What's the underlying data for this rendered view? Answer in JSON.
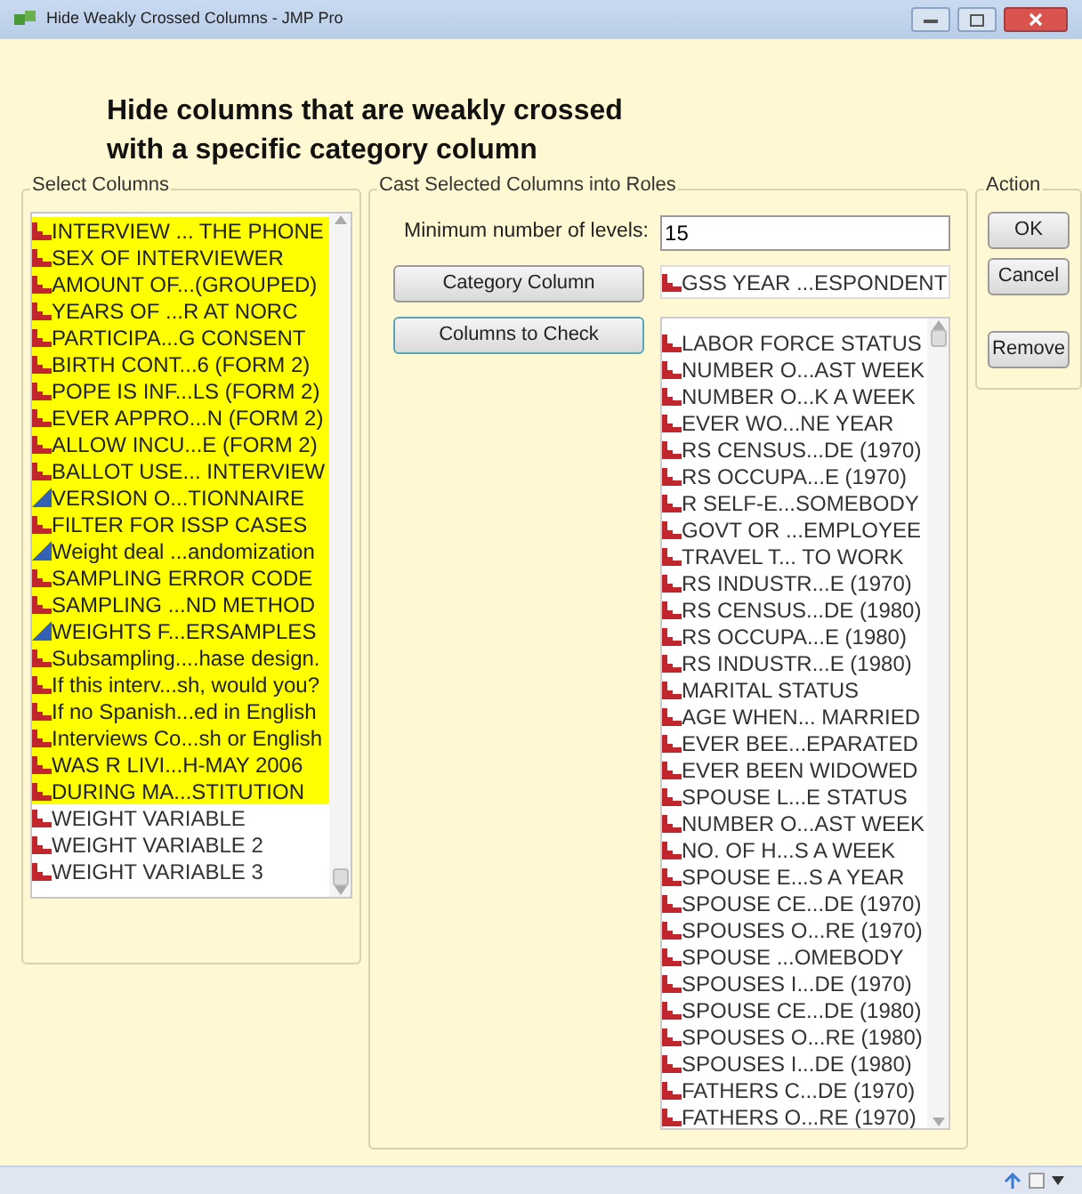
{
  "window": {
    "title": "Hide Weakly Crossed Columns - JMP Pro"
  },
  "heading": [
    "Hide columns that are weakly crossed",
    "with a specific category column"
  ],
  "select_columns": {
    "title": "Select Columns",
    "items": [
      {
        "label": "INTERVIEW ... THE PHONE",
        "kind": "nominal",
        "selected": true
      },
      {
        "label": "SEX OF INTERVIEWER",
        "kind": "nominal",
        "selected": true
      },
      {
        "label": "AMOUNT OF...(GROUPED)",
        "kind": "nominal",
        "selected": true
      },
      {
        "label": "YEARS OF ...R AT NORC",
        "kind": "nominal",
        "selected": true
      },
      {
        "label": "PARTICIPA...G CONSENT",
        "kind": "nominal",
        "selected": true
      },
      {
        "label": "BIRTH CONT...6 (FORM 2)",
        "kind": "nominal",
        "selected": true
      },
      {
        "label": "POPE IS INF...LS (FORM 2)",
        "kind": "nominal",
        "selected": true
      },
      {
        "label": "EVER APPRO...N (FORM 2)",
        "kind": "nominal",
        "selected": true
      },
      {
        "label": "ALLOW INCU...E (FORM 2)",
        "kind": "nominal",
        "selected": true
      },
      {
        "label": "BALLOT USE... INTERVIEW",
        "kind": "nominal",
        "selected": true
      },
      {
        "label": "VERSION O...TIONNAIRE",
        "kind": "continuous",
        "selected": true
      },
      {
        "label": "FILTER FOR ISSP CASES",
        "kind": "nominal",
        "selected": true
      },
      {
        "label": "Weight deal ...andomization",
        "kind": "continuous",
        "selected": true
      },
      {
        "label": "SAMPLING ERROR CODE",
        "kind": "nominal",
        "selected": true
      },
      {
        "label": "SAMPLING ...ND METHOD",
        "kind": "nominal",
        "selected": true
      },
      {
        "label": "WEIGHTS F...ERSAMPLES",
        "kind": "continuous",
        "selected": true
      },
      {
        "label": "Subsampling....hase design.",
        "kind": "nominal",
        "selected": true
      },
      {
        "label": "If this interv...sh, would you?",
        "kind": "nominal",
        "selected": true
      },
      {
        "label": "If no Spanish...ed in English",
        "kind": "nominal",
        "selected": true
      },
      {
        "label": "Interviews Co...sh or English",
        "kind": "nominal",
        "selected": true
      },
      {
        "label": "WAS R LIVI...H-MAY 2006",
        "kind": "nominal",
        "selected": true
      },
      {
        "label": "DURING MA...STITUTION",
        "kind": "nominal",
        "selected": true
      },
      {
        "label": "WEIGHT VARIABLE",
        "kind": "nominal",
        "selected": false
      },
      {
        "label": "WEIGHT VARIABLE 2",
        "kind": "nominal",
        "selected": false
      },
      {
        "label": "WEIGHT VARIABLE 3",
        "kind": "nominal",
        "selected": false
      }
    ]
  },
  "cast_roles": {
    "title": "Cast Selected Columns into Roles",
    "minimum_levels": {
      "label": "Minimum number of levels:",
      "value": "15"
    },
    "category_column": {
      "button": "Category Column",
      "items": [
        {
          "label": "GSS YEAR ...ESPONDENT",
          "kind": "nominal"
        }
      ]
    },
    "columns_to_check": {
      "button": "Columns to Check",
      "items": [
        {
          "label": "LABOR FORCE STATUS",
          "kind": "nominal"
        },
        {
          "label": "NUMBER O...AST WEEK",
          "kind": "nominal"
        },
        {
          "label": "NUMBER O...K A WEEK",
          "kind": "nominal"
        },
        {
          "label": "EVER WO...NE YEAR",
          "kind": "nominal"
        },
        {
          "label": "RS CENSUS...DE (1970)",
          "kind": "nominal"
        },
        {
          "label": "RS OCCUPA...E  (1970)",
          "kind": "nominal"
        },
        {
          "label": "R SELF-E...SOMEBODY",
          "kind": "nominal"
        },
        {
          "label": "GOVT OR ...EMPLOYEE",
          "kind": "nominal"
        },
        {
          "label": "TRAVEL T... TO WORK",
          "kind": "nominal"
        },
        {
          "label": "RS INDUSTR...E  (1970)",
          "kind": "nominal"
        },
        {
          "label": "RS CENSUS...DE (1980)",
          "kind": "nominal"
        },
        {
          "label": "RS OCCUPA...E  (1980)",
          "kind": "nominal"
        },
        {
          "label": "RS INDUSTR...E  (1980)",
          "kind": "nominal"
        },
        {
          "label": "MARITAL STATUS",
          "kind": "nominal"
        },
        {
          "label": "AGE WHEN... MARRIED",
          "kind": "nominal"
        },
        {
          "label": "EVER BEE...EPARATED",
          "kind": "nominal"
        },
        {
          "label": "EVER BEEN WIDOWED",
          "kind": "nominal"
        },
        {
          "label": "SPOUSE L...E STATUS",
          "kind": "nominal"
        },
        {
          "label": "NUMBER O...AST WEEK",
          "kind": "nominal"
        },
        {
          "label": "NO. OF H...S A WEEK",
          "kind": "nominal"
        },
        {
          "label": "SPOUSE E...S A YEAR",
          "kind": "nominal"
        },
        {
          "label": "SPOUSE CE...DE (1970)",
          "kind": "nominal"
        },
        {
          "label": "SPOUSES O...RE (1970)",
          "kind": "nominal"
        },
        {
          "label": "SPOUSE ...OMEBODY",
          "kind": "nominal"
        },
        {
          "label": "SPOUSES I...DE (1970)",
          "kind": "nominal"
        },
        {
          "label": "SPOUSE CE...DE (1980)",
          "kind": "nominal"
        },
        {
          "label": "SPOUSES O...RE (1980)",
          "kind": "nominal"
        },
        {
          "label": "SPOUSES I...DE (1980)",
          "kind": "nominal"
        },
        {
          "label": "FATHERS C...DE (1970)",
          "kind": "nominal"
        },
        {
          "label": "FATHERS O...RE (1970)",
          "kind": "nominal"
        }
      ]
    }
  },
  "action": {
    "title": "Action",
    "buttons": [
      "OK",
      "Cancel",
      "Remove"
    ]
  }
}
